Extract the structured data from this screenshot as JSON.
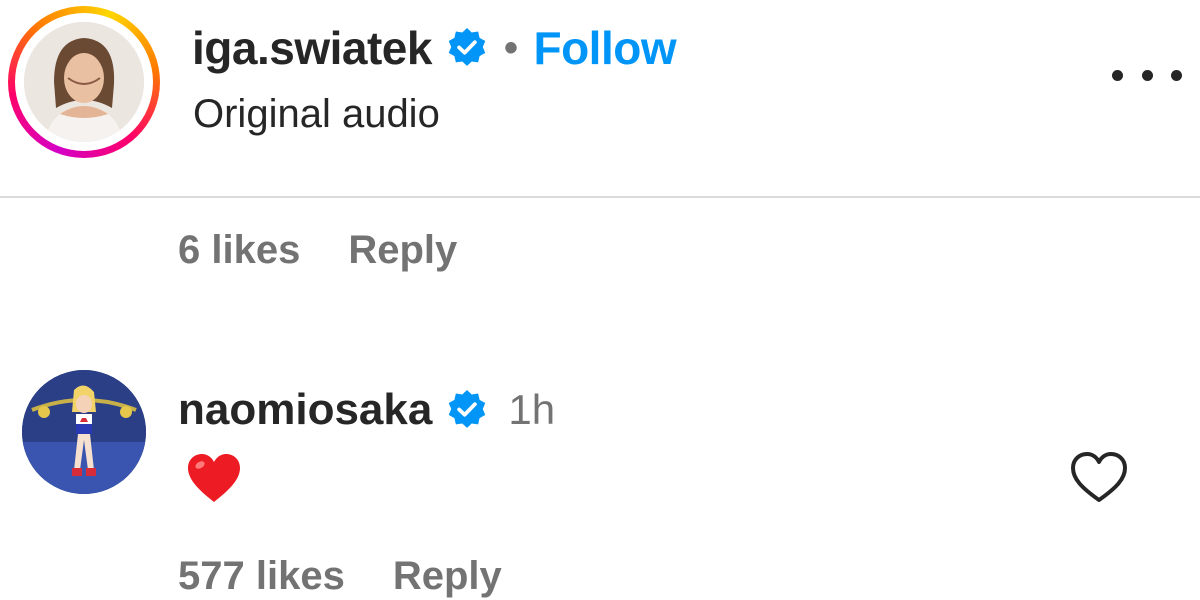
{
  "post_header": {
    "username": "iga.swiatek",
    "separator": "•",
    "follow_label": "Follow",
    "subtitle": "Original audio",
    "verified_icon": "verified-badge-icon",
    "more_icon": "more-options-icon"
  },
  "comments": [
    {
      "likes": "6 likes",
      "reply_label": "Reply"
    },
    {
      "username": "naomiosaka",
      "time": "1h",
      "text_emoji": "red-heart",
      "likes": "577 likes",
      "reply_label": "Reply"
    }
  ],
  "colors": {
    "accent": "#0095f6",
    "muted_text": "#737373",
    "heart_red": "#ed1c24",
    "divider": "#dbdbdb"
  }
}
